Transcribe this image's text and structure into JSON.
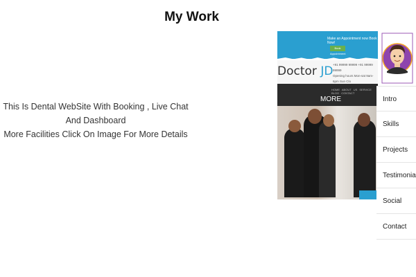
{
  "section": {
    "title": "My Work",
    "description_line1": "This Is Dental WebSite With Booking , Live Chat And Dashboard",
    "description_line2": "More Facilities Click On Image For More Details"
  },
  "project_preview": {
    "appointment_text": "Make an Appointment now Book Now!",
    "appointment_button": "Book Appointment",
    "logo_main": "Doctor ",
    "logo_accent": "JD",
    "contact_line1": "+91 99999 99999 +91 99999 99999",
    "contact_line2": "Opening hours Mon-sat 9am-6pm Sun Clo",
    "nav_links": "HOME ABOUT US SERVICE BLOG CONTACT",
    "overlay_text": "MORE"
  },
  "sidebar": {
    "items": [
      {
        "label": "Intro"
      },
      {
        "label": "Skills"
      },
      {
        "label": "Projects"
      },
      {
        "label": "Testimonials"
      },
      {
        "label": "Social"
      },
      {
        "label": "Contact"
      }
    ]
  },
  "colors": {
    "accent": "#2a9fd0",
    "avatar_bg": "#8e44ad",
    "avatar_ring": "#f5a623"
  }
}
